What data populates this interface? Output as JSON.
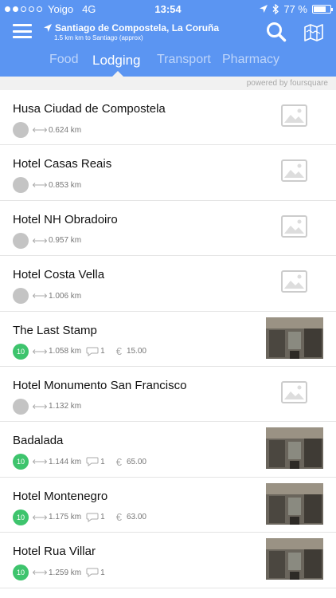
{
  "status": {
    "carrier": "Yoigo",
    "network": "4G",
    "time": "13:54",
    "battery": "77 %",
    "battery_level": 0.77
  },
  "header": {
    "location": "Santiago de Compostela, La Coruña",
    "distance_note": "1.5 km km to Santiago (approx)",
    "tabs": [
      "Food",
      "Lodging",
      "Transport",
      "Pharmacy"
    ],
    "active_tab": "Lodging"
  },
  "powered_by": "powered by foursquare",
  "places": [
    {
      "name": "Husa Ciudad de Compostela",
      "rating": "",
      "distance": "0.624 km",
      "tips": "",
      "price": "",
      "photo": false
    },
    {
      "name": "Hotel Casas Reais",
      "rating": "",
      "distance": "0.853 km",
      "tips": "",
      "price": "",
      "photo": false
    },
    {
      "name": "Hotel NH Obradoiro",
      "rating": "",
      "distance": "0.957 km",
      "tips": "",
      "price": "",
      "photo": false
    },
    {
      "name": "Hotel Costa Vella",
      "rating": "",
      "distance": "1.006 km",
      "tips": "",
      "price": "",
      "photo": false
    },
    {
      "name": "The Last Stamp",
      "rating": "10",
      "distance": "1.058 km",
      "tips": "1",
      "price": "15.00",
      "photo": true
    },
    {
      "name": "Hotel Monumento San Francisco",
      "rating": "",
      "distance": "1.132 km",
      "tips": "",
      "price": "",
      "photo": false
    },
    {
      "name": "Badalada",
      "rating": "10",
      "distance": "1.144 km",
      "tips": "1",
      "price": "65.00",
      "photo": true
    },
    {
      "name": "Hotel Montenegro",
      "rating": "10",
      "distance": "1.175 km",
      "tips": "1",
      "price": "63.00",
      "photo": true
    },
    {
      "name": "Hotel Rua Villar",
      "rating": "10",
      "distance": "1.259 km",
      "tips": "1",
      "price": "",
      "photo": true
    }
  ],
  "colors": {
    "header": "#5b95f2",
    "rating_green": "#3ec46d",
    "no_rating_gray": "#c4c4c4"
  }
}
